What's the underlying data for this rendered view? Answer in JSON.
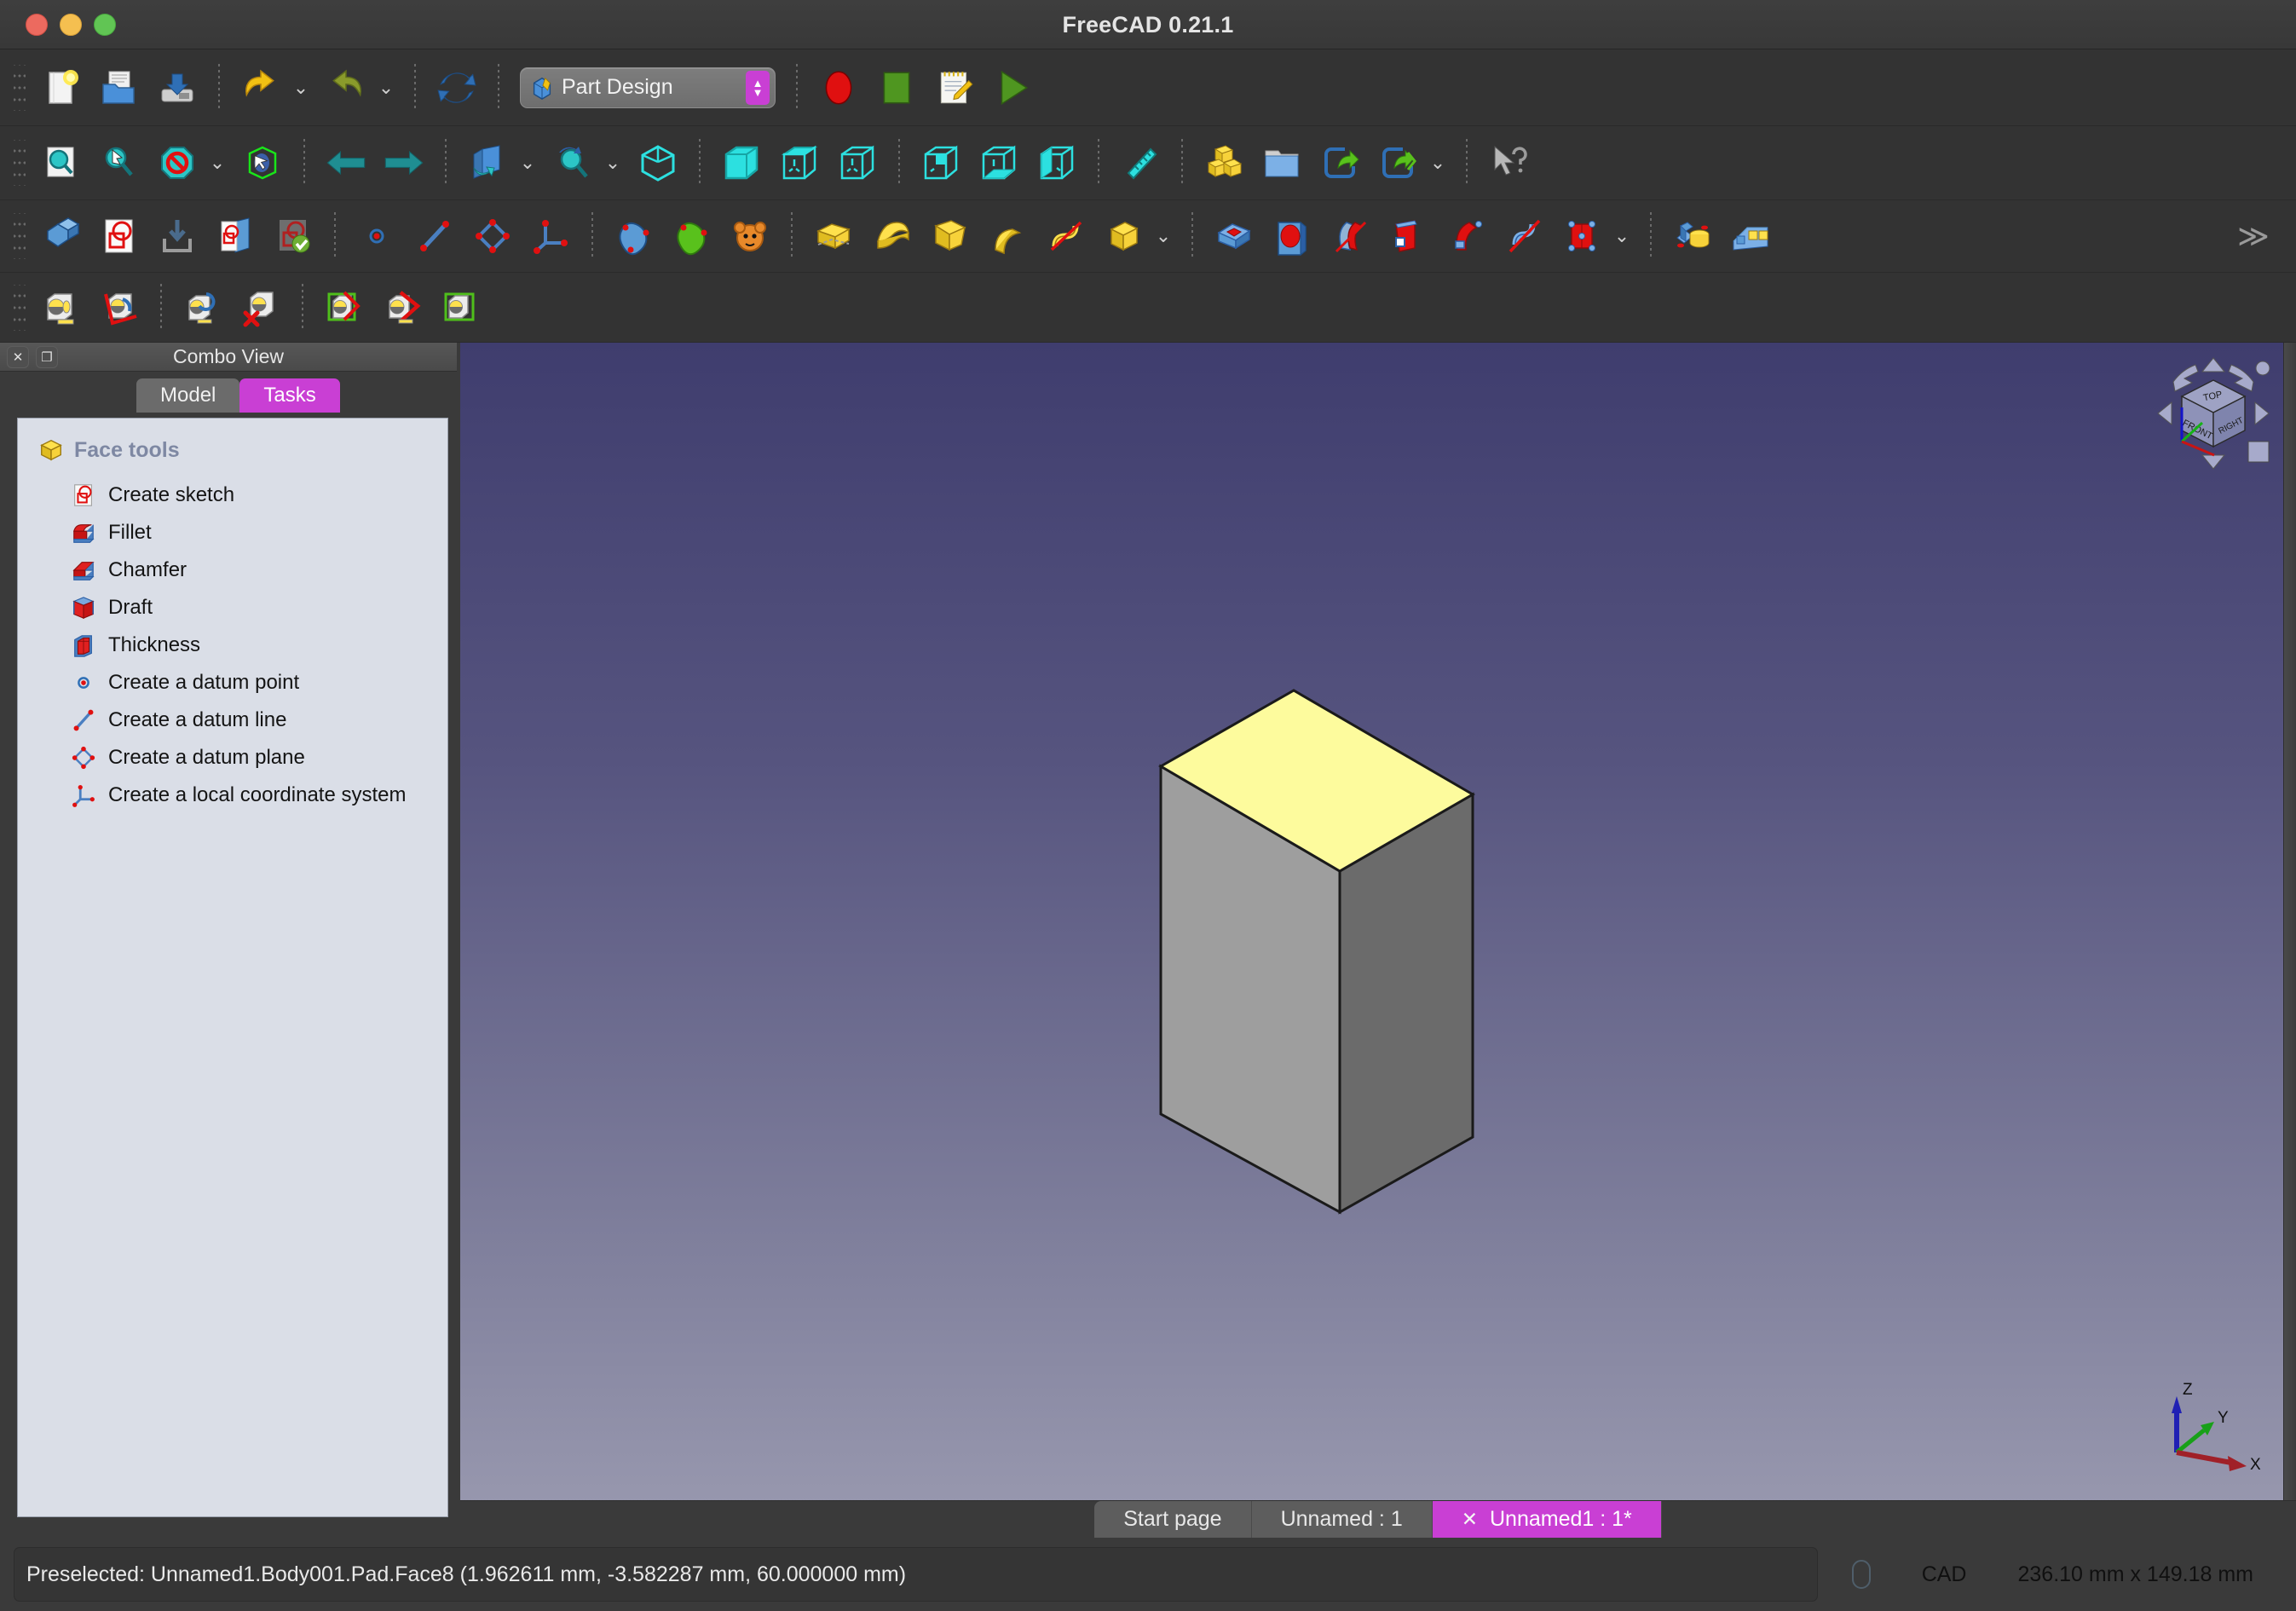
{
  "window": {
    "title": "FreeCAD 0.21.1",
    "traffic_lights": [
      "close",
      "minimize",
      "maximize"
    ]
  },
  "toolbars": {
    "row1": {
      "items": [
        {
          "name": "new-document-button",
          "icon": "new-file-icon"
        },
        {
          "name": "open-document-button",
          "icon": "open-folder-icon"
        },
        {
          "name": "save-document-button",
          "icon": "save-drive-icon"
        },
        {
          "name": "undo-button",
          "icon": "undo-arrow-icon",
          "has_dropdown": true
        },
        {
          "name": "redo-button",
          "icon": "redo-arrow-icon",
          "has_dropdown": true
        },
        {
          "name": "refresh-button",
          "icon": "refresh-icon"
        },
        {
          "name": "workbench-selector",
          "icon": "part-design-icon"
        },
        {
          "name": "macro-record-button",
          "icon": "record-red-circle-icon"
        },
        {
          "name": "macro-stop-button",
          "icon": "stop-green-square-icon"
        },
        {
          "name": "macros-button",
          "icon": "notepad-pencil-icon"
        },
        {
          "name": "execute-macro-button",
          "icon": "play-green-triangle-icon"
        }
      ]
    },
    "row2": {
      "items": [
        {
          "name": "fit-all-button",
          "icon": "zoom-fit-icon"
        },
        {
          "name": "fit-selection-button",
          "icon": "zoom-selection-icon"
        },
        {
          "name": "draw-style-button",
          "icon": "no-entry-icon",
          "has_dropdown": true
        },
        {
          "name": "select-visible-button",
          "icon": "box-cursor-icon"
        },
        {
          "name": "back-button",
          "icon": "arrow-left-icon"
        },
        {
          "name": "forward-button",
          "icon": "arrow-right-icon"
        },
        {
          "name": "std-views-button",
          "icon": "axonometric-icon",
          "has_dropdown": true
        },
        {
          "name": "zoom-button",
          "icon": "zoom-magnifier-icon",
          "has_dropdown": true
        },
        {
          "name": "isometric-view-button",
          "icon": "cube-iso-icon"
        },
        {
          "name": "front-view-button",
          "icon": "cube-front-icon"
        },
        {
          "name": "top-view-button",
          "icon": "cube-top-icon"
        },
        {
          "name": "right-view-button",
          "icon": "cube-right-icon"
        },
        {
          "name": "rear-view-button",
          "icon": "cube-rear-icon"
        },
        {
          "name": "bottom-view-button",
          "icon": "cube-bottom-icon"
        },
        {
          "name": "left-view-button",
          "icon": "cube-left-icon"
        },
        {
          "name": "measure-button",
          "icon": "ruler-icon"
        },
        {
          "name": "part-primitives-button",
          "icon": "gold-blocks-icon"
        },
        {
          "name": "group-button",
          "icon": "blue-folder-icon"
        },
        {
          "name": "link-button",
          "icon": "link-arrow-icon"
        },
        {
          "name": "link-actions-button",
          "icon": "link-multi-arrow-icon",
          "has_dropdown": true
        },
        {
          "name": "whats-this-button",
          "icon": "cursor-question-icon"
        }
      ]
    },
    "row3": {
      "items": [
        {
          "name": "create-body-button",
          "icon": "body-blue-icon"
        },
        {
          "name": "create-sketch-button",
          "icon": "sketch-red-icon"
        },
        {
          "name": "attach-sketch-button",
          "icon": "sketch-attach-icon"
        },
        {
          "name": "edit-sketch-button",
          "icon": "edit-sketch-icon"
        },
        {
          "name": "validate-sketch-button",
          "icon": "validate-sketch-icon"
        },
        {
          "name": "datum-point-button",
          "icon": "datum-point-icon"
        },
        {
          "name": "datum-line-button",
          "icon": "datum-line-icon"
        },
        {
          "name": "datum-plane-button",
          "icon": "datum-plane-icon"
        },
        {
          "name": "local-coordinate-system-button",
          "icon": "local-cs-icon"
        },
        {
          "name": "shapebinder-button",
          "icon": "shapebinder-icon"
        },
        {
          "name": "sub-object-binder-button",
          "icon": "subobject-binder-icon"
        },
        {
          "name": "clone-button",
          "icon": "clone-orange-icon"
        },
        {
          "name": "pad-button",
          "icon": "pad-yellow-icon"
        },
        {
          "name": "revolution-button",
          "icon": "revolution-yellow-icon"
        },
        {
          "name": "additive-loft-button",
          "icon": "loft-yellow-icon"
        },
        {
          "name": "additive-pipe-button",
          "icon": "pipe-yellow-icon"
        },
        {
          "name": "additive-helix-button",
          "icon": "helix-yellow-icon"
        },
        {
          "name": "additive-primitive-button",
          "icon": "additive-box-icon",
          "has_dropdown": true
        },
        {
          "name": "pocket-button",
          "icon": "pocket-red-icon"
        },
        {
          "name": "hole-button",
          "icon": "hole-red-icon"
        },
        {
          "name": "groove-button",
          "icon": "groove-red-icon"
        },
        {
          "name": "subtractive-loft-button",
          "icon": "sub-loft-red-icon"
        },
        {
          "name": "subtractive-pipe-button",
          "icon": "sub-pipe-red-icon"
        },
        {
          "name": "subtractive-helix-button",
          "icon": "sub-helix-red-icon"
        },
        {
          "name": "subtractive-primitive-button",
          "icon": "sub-box-red-icon",
          "has_dropdown": true
        },
        {
          "name": "boolean-button",
          "icon": "boolean-blue-yellow-icon"
        },
        {
          "name": "pattern-button",
          "icon": "pattern-blue-yellow-icon"
        },
        {
          "name": "toolbar-overflow-button",
          "icon": "double-chevron-right-icon"
        }
      ]
    },
    "row4": {
      "items": [
        {
          "name": "measure-tool-button",
          "icon": "tape-measure-icon"
        },
        {
          "name": "measure-angle-button",
          "icon": "tape-angle-icon"
        },
        {
          "name": "measure-refresh-button",
          "icon": "tape-refresh-icon"
        },
        {
          "name": "measure-clear-all-button",
          "icon": "tape-clear-icon"
        },
        {
          "name": "measure-toggle-all-button",
          "icon": "tape-toggle-all-icon"
        },
        {
          "name": "measure-toggle-3d-button",
          "icon": "tape-toggle-3d-icon"
        },
        {
          "name": "measure-toggle-delta-button",
          "icon": "tape-toggle-delta-icon"
        }
      ]
    }
  },
  "workbench": {
    "label": "Part Design"
  },
  "combo_view": {
    "title": "Combo View",
    "close_icon": "close-x-icon",
    "float_icon": "undock-icon",
    "tabs": [
      {
        "label": "Model",
        "active": false
      },
      {
        "label": "Tasks",
        "active": true
      }
    ],
    "task_group": {
      "title": "Face tools",
      "icon": "yellow-cube-icon",
      "items": [
        {
          "label": "Create sketch",
          "icon": "sketch-red-icon"
        },
        {
          "label": "Fillet",
          "icon": "fillet-icon"
        },
        {
          "label": "Chamfer",
          "icon": "chamfer-icon"
        },
        {
          "label": "Draft",
          "icon": "draft-icon"
        },
        {
          "label": "Thickness",
          "icon": "thickness-icon"
        },
        {
          "label": "Create a datum point",
          "icon": "datum-point-icon"
        },
        {
          "label": "Create a datum line",
          "icon": "datum-line-icon"
        },
        {
          "label": "Create a datum plane",
          "icon": "datum-plane-icon"
        },
        {
          "label": "Create a local coordinate system",
          "icon": "local-cs-icon"
        }
      ]
    }
  },
  "view3d": {
    "navigation_cube": {
      "face_top": "TOP",
      "face_front": "FRONT",
      "face_right": "RIGHT"
    },
    "axis_indicator": {
      "x": "X",
      "y": "Y",
      "z": "Z",
      "x_color": "#a02028",
      "y_color": "#18a018",
      "z_color": "#2020b4"
    },
    "model": {
      "name": "pad-box",
      "top_face_color": "#fdfb9d",
      "front_face_color": "#9e9e9e",
      "side_face_color": "#6b6b6b",
      "edge_color": "#1a1a1a"
    },
    "background_top_color": "#3f3d6e",
    "background_bottom_color": "#9a9ab0"
  },
  "document_tabs": [
    {
      "label": "Start page",
      "active": false,
      "closable": false
    },
    {
      "label": "Unnamed : 1",
      "active": false,
      "closable": false
    },
    {
      "label": "Unnamed1 : 1*",
      "active": true,
      "closable": true,
      "close_icon": "close-x-icon"
    }
  ],
  "status_bar": {
    "message": "Preselected: Unnamed1.Body001.Pad.Face8 (1.962611 mm, -3.582287 mm, 60.000000 mm)",
    "navigation_style": "CAD",
    "dimensions": "236.10 mm x 149.18 mm",
    "mouse_icon": "mouse-icon"
  }
}
